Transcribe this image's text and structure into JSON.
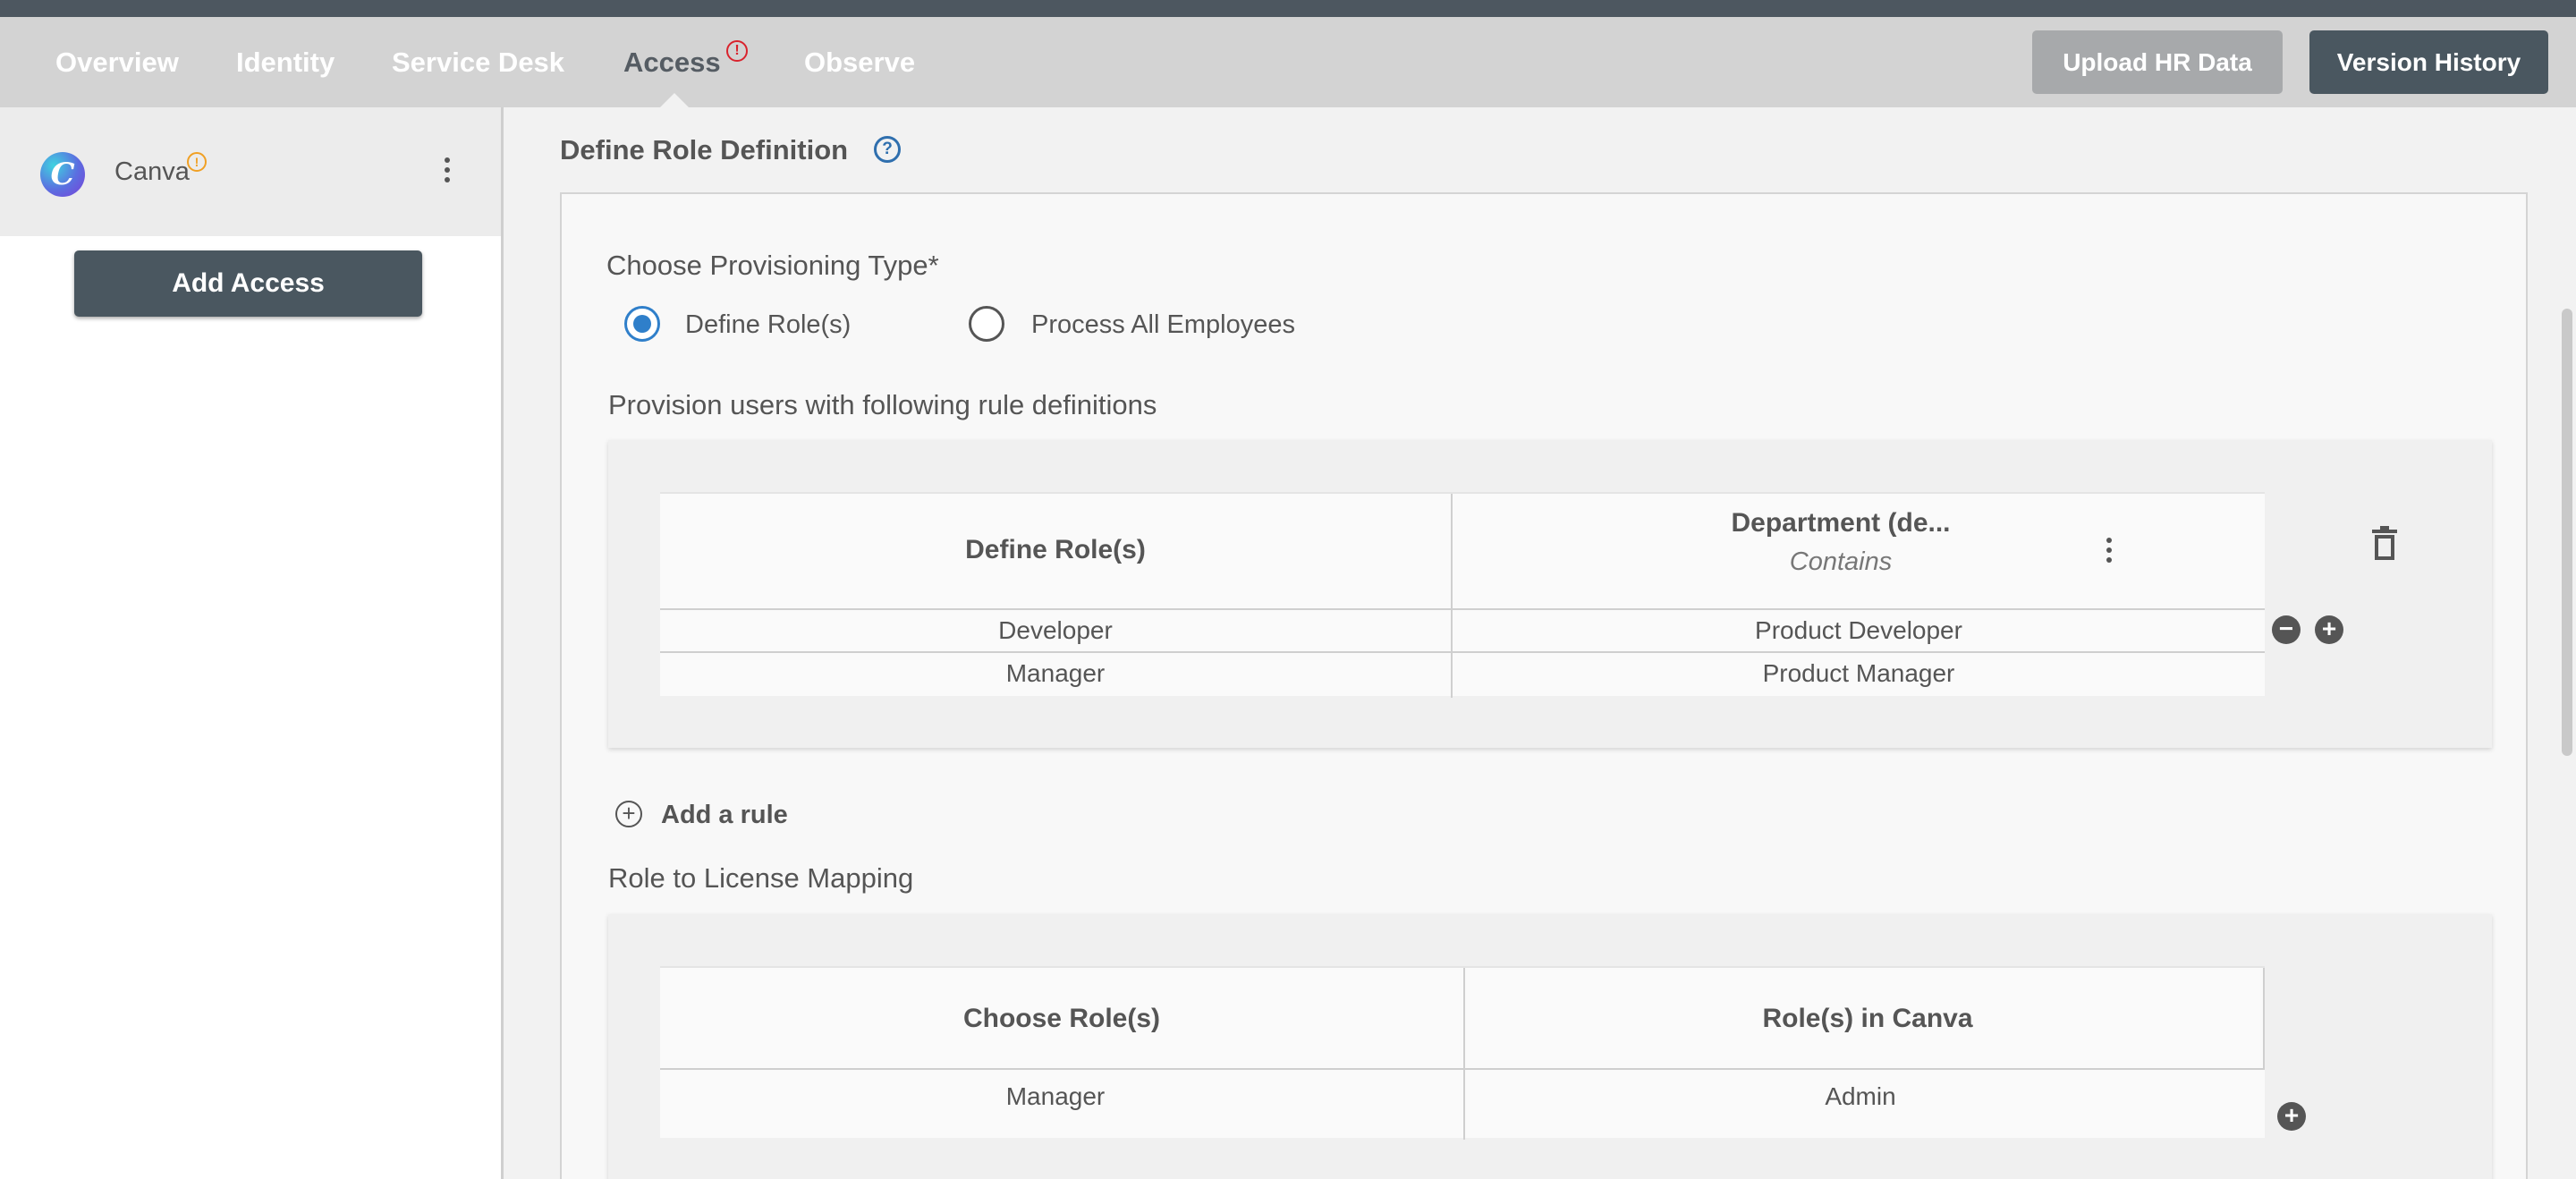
{
  "nav": {
    "tabs": [
      {
        "label": "Overview"
      },
      {
        "label": "Identity"
      },
      {
        "label": "Service Desk"
      },
      {
        "label": "Access",
        "alert": "!"
      },
      {
        "label": "Observe"
      }
    ],
    "upload_label": "Upload HR Data",
    "version_label": "Version History"
  },
  "sidebar": {
    "app_name": "Canva",
    "app_logo_letter": "C",
    "app_warning": "!",
    "add_access_label": "Add Access"
  },
  "main": {
    "section_title": "Define Role Definition",
    "help": "?",
    "provisioning_label": "Choose Provisioning Type*",
    "options": [
      {
        "label": "Define Role(s)",
        "checked": true
      },
      {
        "label": "Process All Employees",
        "checked": false
      }
    ],
    "rules_label": "Provision users with following rule definitions",
    "rules_table": {
      "col1": "Define Role(s)",
      "col2": "Department (de...",
      "col2_sub": "Contains",
      "rows": [
        [
          "Developer",
          "Product Developer"
        ],
        [
          "Manager",
          "Product Manager"
        ]
      ]
    },
    "add_rule_label": "Add a rule",
    "mapping_label": "Role to License Mapping",
    "mapping_table": {
      "col1": "Choose Role(s)",
      "col2": "Role(s) in Canva",
      "rows": [
        [
          "Manager",
          "Admin"
        ]
      ]
    }
  },
  "colors": {
    "nav_bg": "#d3d3d3",
    "dark_button": "#4a5760",
    "radio_accent": "#2f7fca",
    "alert_red": "#d9232d",
    "warning_orange": "#f0a024"
  },
  "icons": {
    "sidebar_menu": "kebab-icon",
    "column_menu": "kebab-icon",
    "delete_rule_table": "trash-icon",
    "remove_row": "minus-circle-icon",
    "add_row": "plus-circle-icon",
    "add_rule": "plus-circle-outline-icon",
    "help": "question-circle-icon"
  }
}
